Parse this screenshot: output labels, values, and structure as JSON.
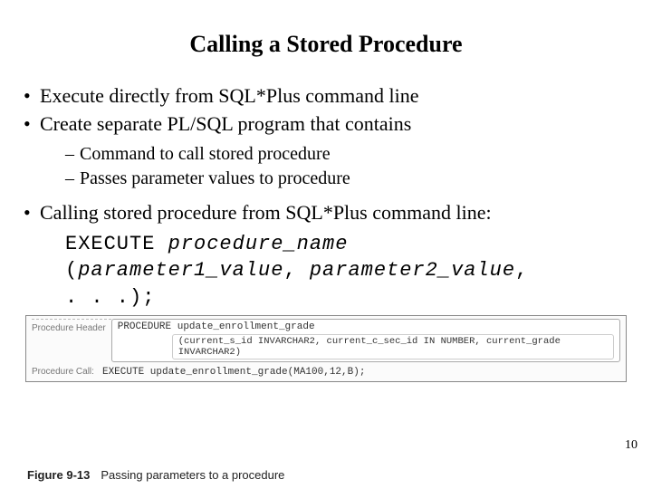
{
  "title": "Calling a Stored Procedure",
  "bullets": {
    "b1": "Execute directly from SQL*Plus command line",
    "b2": "Create separate PL/SQL program that contains",
    "b2_sub1": "Command to call stored procedure",
    "b2_sub2": "Passes parameter values to procedure",
    "b3": "Calling stored procedure from SQL*Plus command line:"
  },
  "code": {
    "kw_execute": "EXECUTE ",
    "proc_name": "procedure_name",
    "lparen": "(",
    "param1": "parameter1_value",
    "comma_sp": ", ",
    "param2": "parameter2_value",
    "tail": ",",
    "ellipsis": ". . .);"
  },
  "figure": {
    "header_label": "Procedure Header",
    "proc_decl": "PROCEDURE update_enrollment_grade",
    "proc_sig": "(current_s_id INVARCHAR2, current_c_sec_id IN NUMBER, current_grade INVARCHAR2)",
    "call_label": "Procedure Call:",
    "call_stmt": "EXECUTE update_enrollment_grade(MA100,12,B);"
  },
  "caption_fig": "Figure 9-13",
  "caption_text": "Passing parameters to a procedure",
  "page_num": "10"
}
